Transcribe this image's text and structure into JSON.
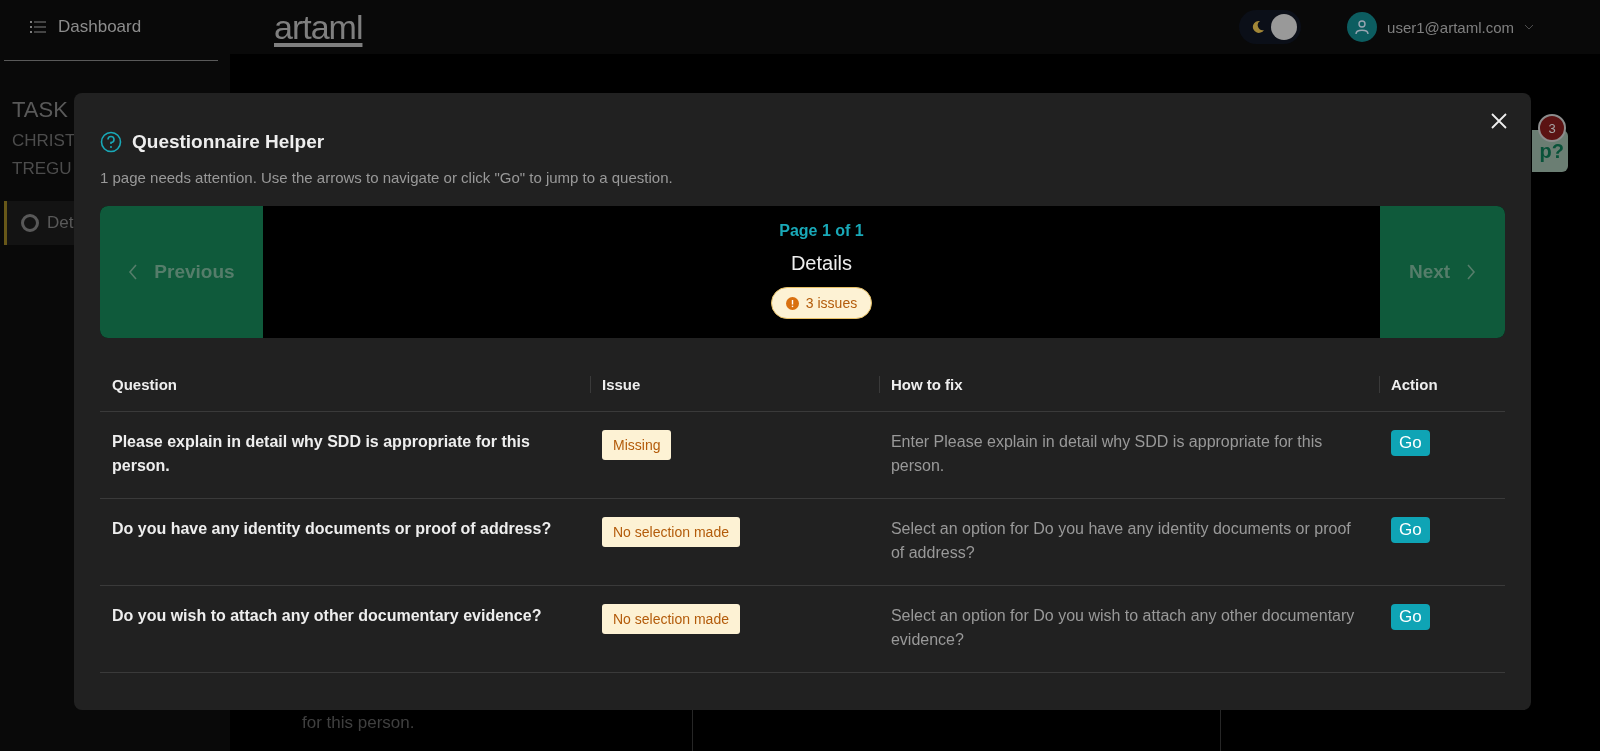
{
  "topbar": {
    "menu_label": "Dashboard",
    "logo": "artaml",
    "dark_mode": true,
    "user_email": "user1@artaml.com"
  },
  "sidebar": {
    "title": "TASK",
    "subtitle_lines": [
      "CHRIST",
      "TREGU"
    ],
    "items": [
      {
        "label": "Det",
        "selected": true
      }
    ]
  },
  "background": {
    "text": "for this person.",
    "help_button": {
      "label": "p?",
      "badge": "3"
    }
  },
  "modal": {
    "title": "Questionnaire Helper",
    "subtitle": "1 page needs attention. Use the arrows to navigate or click \"Go\" to jump to a question.",
    "navigator": {
      "previous": {
        "label": "Previous",
        "disabled": true
      },
      "page_label": "Page 1 of 1",
      "section": "Details",
      "issues_badge": "3 issues",
      "next": {
        "label": "Next",
        "disabled": true
      }
    },
    "table": {
      "columns": [
        "Question",
        "Issue",
        "How to fix",
        "Action"
      ],
      "rows": [
        {
          "question": "Please explain in detail why SDD is appropriate for this person.",
          "issue": "Missing",
          "fix": "Enter Please explain in detail why SDD is appropriate for this person.",
          "action": "Go"
        },
        {
          "question": "Do you have any identity documents or proof of address?",
          "issue": "No selection made",
          "fix": "Select an option for Do you have any identity documents or proof of address?",
          "action": "Go"
        },
        {
          "question": "Do you wish to attach any other documentary evidence?",
          "issue": "No selection made",
          "fix": "Select an option for Do you wish to attach any other documentary evidence?",
          "action": "Go"
        }
      ]
    }
  }
}
